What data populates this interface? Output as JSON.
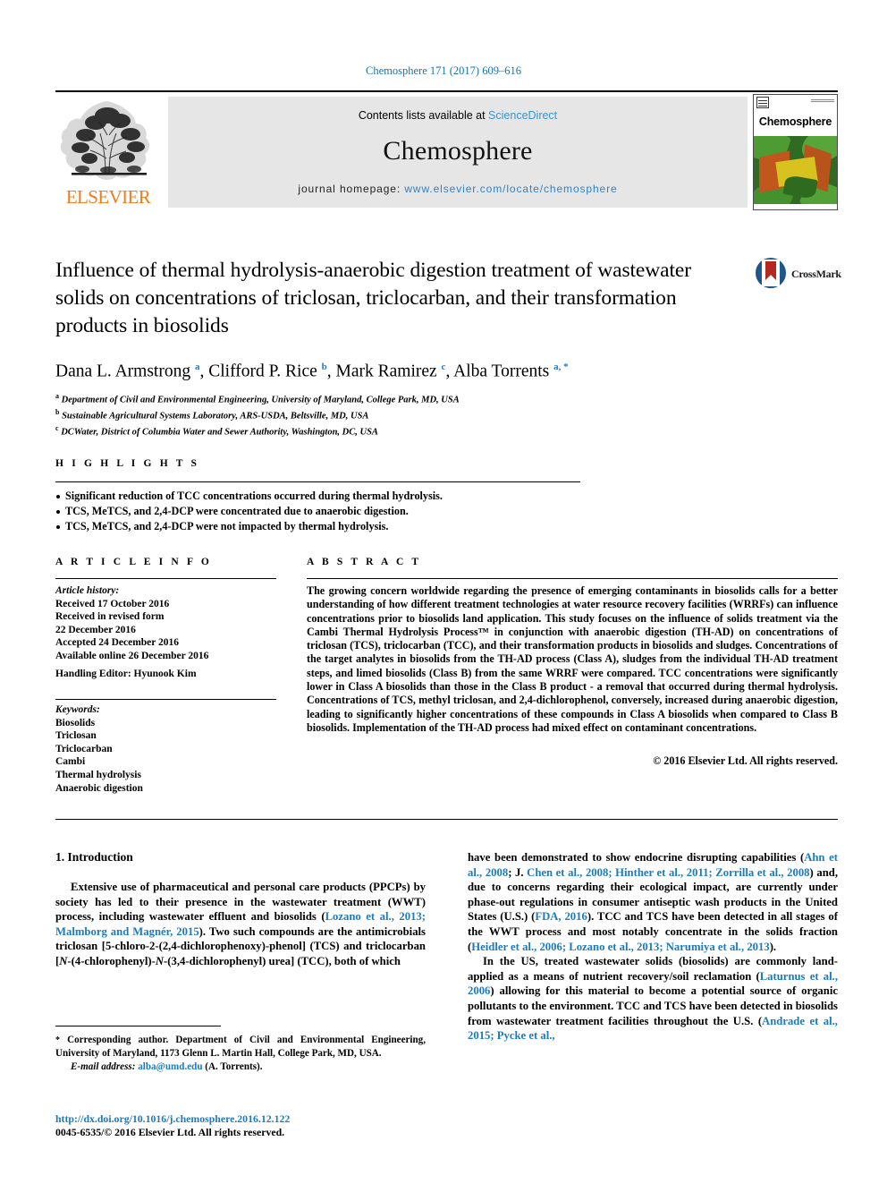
{
  "running_head": "Chemosphere 171 (2017) 609–616",
  "masthead": {
    "contents_prefix": "Contents lists available at ",
    "sciencedirect": "ScienceDirect",
    "journal_name": "Chemosphere",
    "homepage_prefix": "journal homepage: ",
    "homepage_url": "www.elsevier.com/locate/chemosphere",
    "publisher_wordmark": "ELSEVIER",
    "cover_title": "Chemosphere"
  },
  "crossmark": {
    "label": "CrossMark"
  },
  "article": {
    "title": "Influence of thermal hydrolysis-anaerobic digestion treatment of wastewater solids on concentrations of triclosan, triclocarban, and their transformation products in biosolids",
    "authors_html": "Dana L. Armstrong <sup>a</sup>, Clifford P. Rice <sup>b</sup>, Mark Ramirez <sup>c</sup>, Alba Torrents <sup>a, *</sup>",
    "affiliations": [
      {
        "marker": "a",
        "text": "Department of Civil and Environmental Engineering, University of Maryland, College Park, MD, USA"
      },
      {
        "marker": "b",
        "text": "Sustainable Agricultural Systems Laboratory, ARS-USDA, Beltsville, MD, USA"
      },
      {
        "marker": "c",
        "text": "DCWater, District of Columbia Water and Sewer Authority, Washington, DC, USA"
      }
    ]
  },
  "highlights": {
    "heading": "H I G H L I G H T S",
    "items": [
      "Significant reduction of TCC concentrations occurred during thermal hydrolysis.",
      "TCS, MeTCS, and 2,4-DCP were concentrated due to anaerobic digestion.",
      "TCS, MeTCS, and 2,4-DCP were not impacted by thermal hydrolysis."
    ]
  },
  "article_info": {
    "heading": "A R T I C L E  I N F O",
    "history_label": "Article history:",
    "history_lines": [
      "Received 17 October 2016",
      "Received in revised form",
      "22 December 2016",
      "Accepted 24 December 2016",
      "Available online 26 December 2016"
    ],
    "handling_editor": "Handling Editor: Hyunook Kim",
    "keywords_label": "Keywords:",
    "keywords": [
      "Biosolids",
      "Triclosan",
      "Triclocarban",
      "Cambi",
      "Thermal hydrolysis",
      "Anaerobic digestion"
    ]
  },
  "abstract": {
    "heading": "A B S T R A C T",
    "text": "The growing concern worldwide regarding the presence of emerging contaminants in biosolids calls for a better understanding of how different treatment technologies at water resource recovery facilities (WRRFs) can influence concentrations prior to biosolids land application. This study focuses on the influence of solids treatment via the Cambi Thermal Hydrolysis Process™ in conjunction with anaerobic digestion (TH-AD) on concentrations of triclosan (TCS), triclocarban (TCC), and their transformation products in biosolids and sludges. Concentrations of the target analytes in biosolids from the TH-AD process (Class A), sludges from the individual TH-AD treatment steps, and limed biosolids (Class B) from the same WRRF were compared. TCC concentrations were significantly lower in Class A biosolids than those in the Class B product - a removal that occurred during thermal hydrolysis. Concentrations of TCS, methyl triclosan, and 2,4-dichlorophenol, conversely, increased during anaerobic digestion, leading to significantly higher concentrations of these compounds in Class A biosolids when compared to Class B biosolids. Implementation of the TH-AD process had mixed effect on contaminant concentrations.",
    "copyright": "© 2016 Elsevier Ltd. All rights reserved."
  },
  "introduction": {
    "heading": "1. Introduction",
    "left_paragraph_html": "Extensive use of pharmaceutical and personal care products (PPCPs) by society has led to their presence in the wastewater treatment (WWT) process, including wastewater effluent and biosolids (<span class=\"ref\">Lozano et al., 2013; Malmborg and Magnér, 2015</span>). Two such compounds are the antimicrobials triclosan [5-chloro-2-(2,4-dichlorophenoxy)-phenol] (TCS) and triclocarban [<i>N</i>-(4-chlorophenyl)-<i>N</i>-(3,4-dichlorophenyl) urea] (TCC), both of which",
    "right_paragraph1_html": "have been demonstrated to show endocrine disrupting capabilities (<span class=\"ref\">Ahn et al., 2008</span>; J. <span class=\"ref\">Chen et al., 2008; Hinther et al., 2011; Zorrilla et al., 2008</span>) and, due to concerns regarding their ecological impact, are currently under phase-out regulations in consumer antiseptic wash products in the United States (U.S.) (<span class=\"ref\">FDA, 2016</span>). TCC and TCS have been detected in all stages of the WWT process and most notably concentrate in the solids fraction (<span class=\"ref\">Heidler et al., 2006; Lozano et al., 2013; Narumiya et al., 2013</span>).",
    "right_paragraph2_html": "In the US, treated wastewater solids (biosolids) are commonly land-applied as a means of nutrient recovery/soil reclamation (<span class=\"ref\">Laturnus et al., 2006</span>) allowing for this material to become a potential source of organic pollutants to the environment. TCC and TCS have been detected in biosolids from wastewater treatment facilities throughout the U.S. (<span class=\"ref\">Andrade et al., 2015; Pycke et al.,</span>"
  },
  "footnotes": {
    "corresponding_html": "<span class=\"star\">*</span> Corresponding author. Department of Civil and Environmental Engineering, University of Maryland, 1173 Glenn L. Martin Hall, College Park, MD, USA.",
    "email_label": "E-mail address:",
    "email": "alba@umd.edu",
    "email_suffix": "(A. Torrents)."
  },
  "doi": "http://dx.doi.org/10.1016/j.chemosphere.2016.12.122",
  "issn_line": "0045-6535/© 2016 Elsevier Ltd. All rights reserved.",
  "colors": {
    "link": "#1b7bbd",
    "running_head": "#1a74a8",
    "elsevier_orange": "#f07c1a",
    "masthead_bg": "#e6e6e6"
  }
}
